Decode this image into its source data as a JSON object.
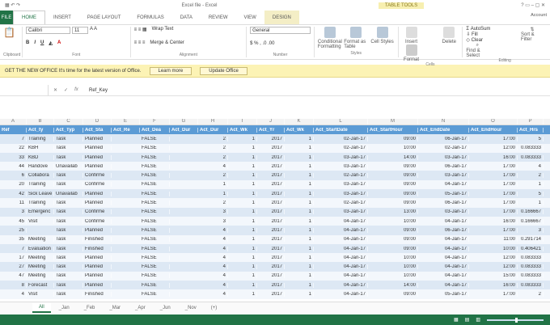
{
  "window": {
    "title": "Excel file - Excel",
    "context_tab": "TABLE TOOLS",
    "user": "Account"
  },
  "tabs": [
    "FILE",
    "HOME",
    "INSERT",
    "PAGE LAYOUT",
    "FORMULAS",
    "DATA",
    "REVIEW",
    "VIEW",
    "DESIGN"
  ],
  "ribbon": {
    "font": "Calibri",
    "size": "11",
    "wrap": "Wrap Text",
    "merge": "Merge & Center",
    "number_format": "General",
    "cond_format": "Conditional Formatting",
    "format_table": "Format as Table",
    "cell_styles": "Cell Styles",
    "insert": "Insert",
    "delete": "Delete",
    "format": "Format",
    "autosum": "AutoSum",
    "fill": "Fill",
    "clear": "Clear",
    "sort": "Sort & Filter",
    "find": "Find & Select",
    "groups": [
      "Clipboard",
      "Font",
      "Alignment",
      "Number",
      "Styles",
      "Cells",
      "Editing"
    ]
  },
  "message": {
    "text": "GET THE NEW OFFICE  It's time for the latest version of Office.",
    "btn1": "Learn more",
    "btn2": "Update Office"
  },
  "formula": {
    "name_box": "",
    "value": "Ref_Key"
  },
  "columns": [
    "A",
    "B",
    "C",
    "D",
    "E",
    "F",
    "G",
    "H",
    "I",
    "J",
    "K",
    "L",
    "M",
    "N",
    "O",
    "P"
  ],
  "headers": [
    "Ref",
    "Act_ty",
    "Act_Typ",
    "Act_Sta",
    "Act_Re",
    "Act_Dea",
    "Act_Dur",
    "Act_Dur",
    "Act_Wk",
    "Act_Yr",
    "Act_Wk",
    "Act_StartDate",
    "Act_StartHour",
    "Act_EndDate",
    "Act_EndHour",
    "Act_Hrs"
  ],
  "rows": [
    [
      "7",
      "Training",
      "Task",
      "Planned",
      "",
      "FALSE",
      "",
      "2",
      "1",
      "2017",
      "1",
      "02-Jan-17",
      "09:00",
      "06-Jan-17",
      "17:00",
      "5"
    ],
    [
      "22",
      "KBH",
      "Task",
      "Planned",
      "",
      "FALSE",
      "",
      "2",
      "1",
      "2017",
      "1",
      "02-Jan-17",
      "10:00",
      "02-Jan-17",
      "12:00",
      "0.083333"
    ],
    [
      "33",
      "KBD",
      "Task",
      "Planned",
      "",
      "FALSE",
      "",
      "2",
      "1",
      "2017",
      "1",
      "03-Jan-17",
      "14:00",
      "03-Jan-17",
      "16:00",
      "0.083333"
    ],
    [
      "44",
      "Handove",
      "Unavailab",
      "Planned",
      "",
      "FALSE",
      "",
      "4",
      "1",
      "2017",
      "1",
      "03-Jan-17",
      "09:00",
      "06-Jan-17",
      "17:00",
      "4"
    ],
    [
      "6",
      "Collabora",
      "Task",
      "Confirme",
      "",
      "FALSE",
      "",
      "2",
      "1",
      "2017",
      "1",
      "02-Jan-17",
      "09:00",
      "03-Jan-17",
      "17:00",
      "2"
    ],
    [
      "20",
      "Training",
      "Task",
      "Confirme",
      "",
      "FALSE",
      "",
      "1",
      "1",
      "2017",
      "1",
      "03-Jan-17",
      "09:00",
      "04-Jan-17",
      "17:00",
      "1"
    ],
    [
      "42",
      "Sick Leave",
      "Unavailab",
      "Planned",
      "",
      "FALSE",
      "",
      "1",
      "1",
      "2017",
      "1",
      "03-Jan-17",
      "09:00",
      "05-Jan-17",
      "17:00",
      "5"
    ],
    [
      "11",
      "Training",
      "Task",
      "Planned",
      "",
      "FALSE",
      "",
      "2",
      "1",
      "2017",
      "1",
      "02-Jan-17",
      "09:00",
      "06-Jan-17",
      "17:00",
      "1"
    ],
    [
      "3",
      "Emergenc",
      "Task",
      "Confirme",
      "",
      "FALSE",
      "",
      "3",
      "1",
      "2017",
      "1",
      "03-Jan-17",
      "13:00",
      "03-Jan-17",
      "17:00",
      "0.166667"
    ],
    [
      "45",
      "Visit",
      "Task",
      "Confirme",
      "",
      "FALSE",
      "",
      "3",
      "1",
      "2017",
      "1",
      "04-Jan-17",
      "10:00",
      "04-Jan-17",
      "16:00",
      "0.166667"
    ],
    [
      "25",
      "",
      "Task",
      "Planned",
      "",
      "FALSE",
      "",
      "4",
      "1",
      "2017",
      "1",
      "04-Jan-17",
      "09:00",
      "06-Jan-17",
      "17:00",
      "3"
    ],
    [
      "35",
      "Meeting",
      "Task",
      "Finished",
      "",
      "FALSE",
      "",
      "4",
      "1",
      "2017",
      "1",
      "04-Jan-17",
      "09:00",
      "04-Jan-17",
      "11:00",
      "0.291714"
    ],
    [
      "7",
      "Evaluation",
      "Task",
      "Finished",
      "",
      "FALSE",
      "",
      "4",
      "1",
      "2017",
      "1",
      "04-Jan-17",
      "09:00",
      "04-Jan-17",
      "10:00",
      "0.406421"
    ],
    [
      "17",
      "Meeting",
      "Task",
      "Planned",
      "",
      "FALSE",
      "",
      "4",
      "1",
      "2017",
      "1",
      "04-Jan-17",
      "10:00",
      "04-Jan-17",
      "12:00",
      "0.083333"
    ],
    [
      "27",
      "Meeting",
      "Task",
      "Planned",
      "",
      "FALSE",
      "",
      "4",
      "1",
      "2017",
      "1",
      "04-Jan-17",
      "10:00",
      "04-Jan-17",
      "12:00",
      "0.083333"
    ],
    [
      "47",
      "Meeting",
      "Task",
      "Planned",
      "",
      "FALSE",
      "",
      "4",
      "1",
      "2017",
      "1",
      "04-Jan-17",
      "10:00",
      "04-Jan-17",
      "15:00",
      "0.083333"
    ],
    [
      "8",
      "Forecast",
      "Task",
      "Planned",
      "",
      "FALSE",
      "",
      "4",
      "1",
      "2017",
      "1",
      "04-Jan-17",
      "14:00",
      "04-Jan-17",
      "16:00",
      "0.083333"
    ],
    [
      "4",
      "Visit",
      "Task",
      "Finished",
      "",
      "FALSE",
      "",
      "4",
      "1",
      "2017",
      "1",
      "04-Jan-17",
      "09:00",
      "05-Jan-17",
      "17:00",
      "2"
    ]
  ],
  "sheets": [
    "All",
    "_Jan",
    "_Feb",
    "_Mar",
    "_Apr",
    "_Jun",
    "_Nov",
    "(+)"
  ],
  "colors": {
    "accent": "#217346",
    "header": "#5b9bd5",
    "band": "#dde8f4"
  }
}
